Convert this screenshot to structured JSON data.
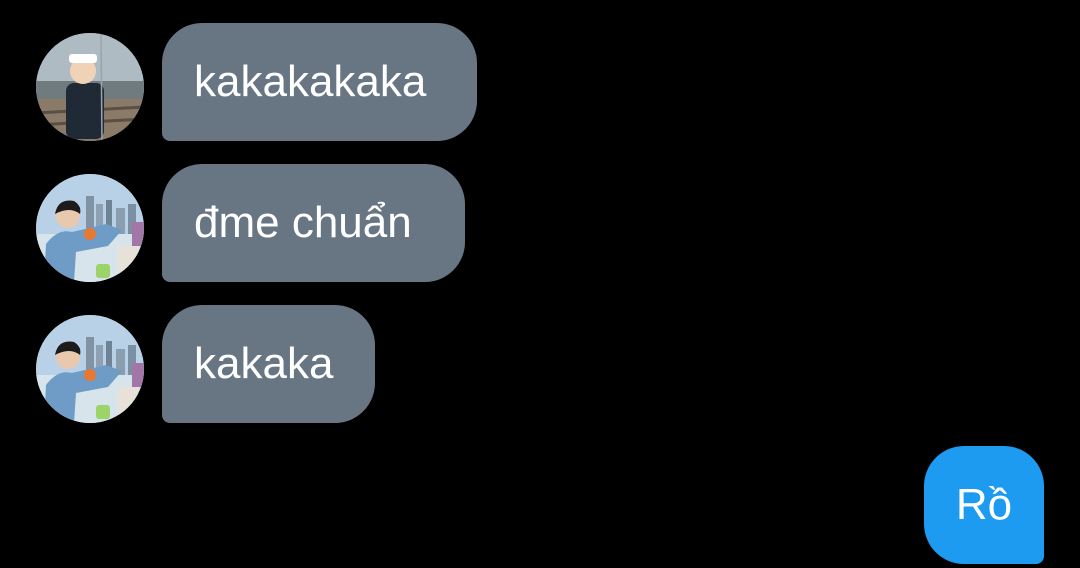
{
  "messages": [
    {
      "direction": "incoming",
      "avatar": "child-photo-avatar",
      "text": "kakakakaka"
    },
    {
      "direction": "incoming",
      "avatar": "man-waterfront-photo-avatar",
      "text": "đme chuẩn"
    },
    {
      "direction": "incoming",
      "avatar": "man-waterfront-photo-avatar",
      "text": "kakaka"
    },
    {
      "direction": "outgoing",
      "text": "Rồ"
    }
  ],
  "colors": {
    "background": "#000000",
    "incoming_bubble": "#687684",
    "outgoing_bubble": "#1d9bf0",
    "text": "#ffffff"
  }
}
